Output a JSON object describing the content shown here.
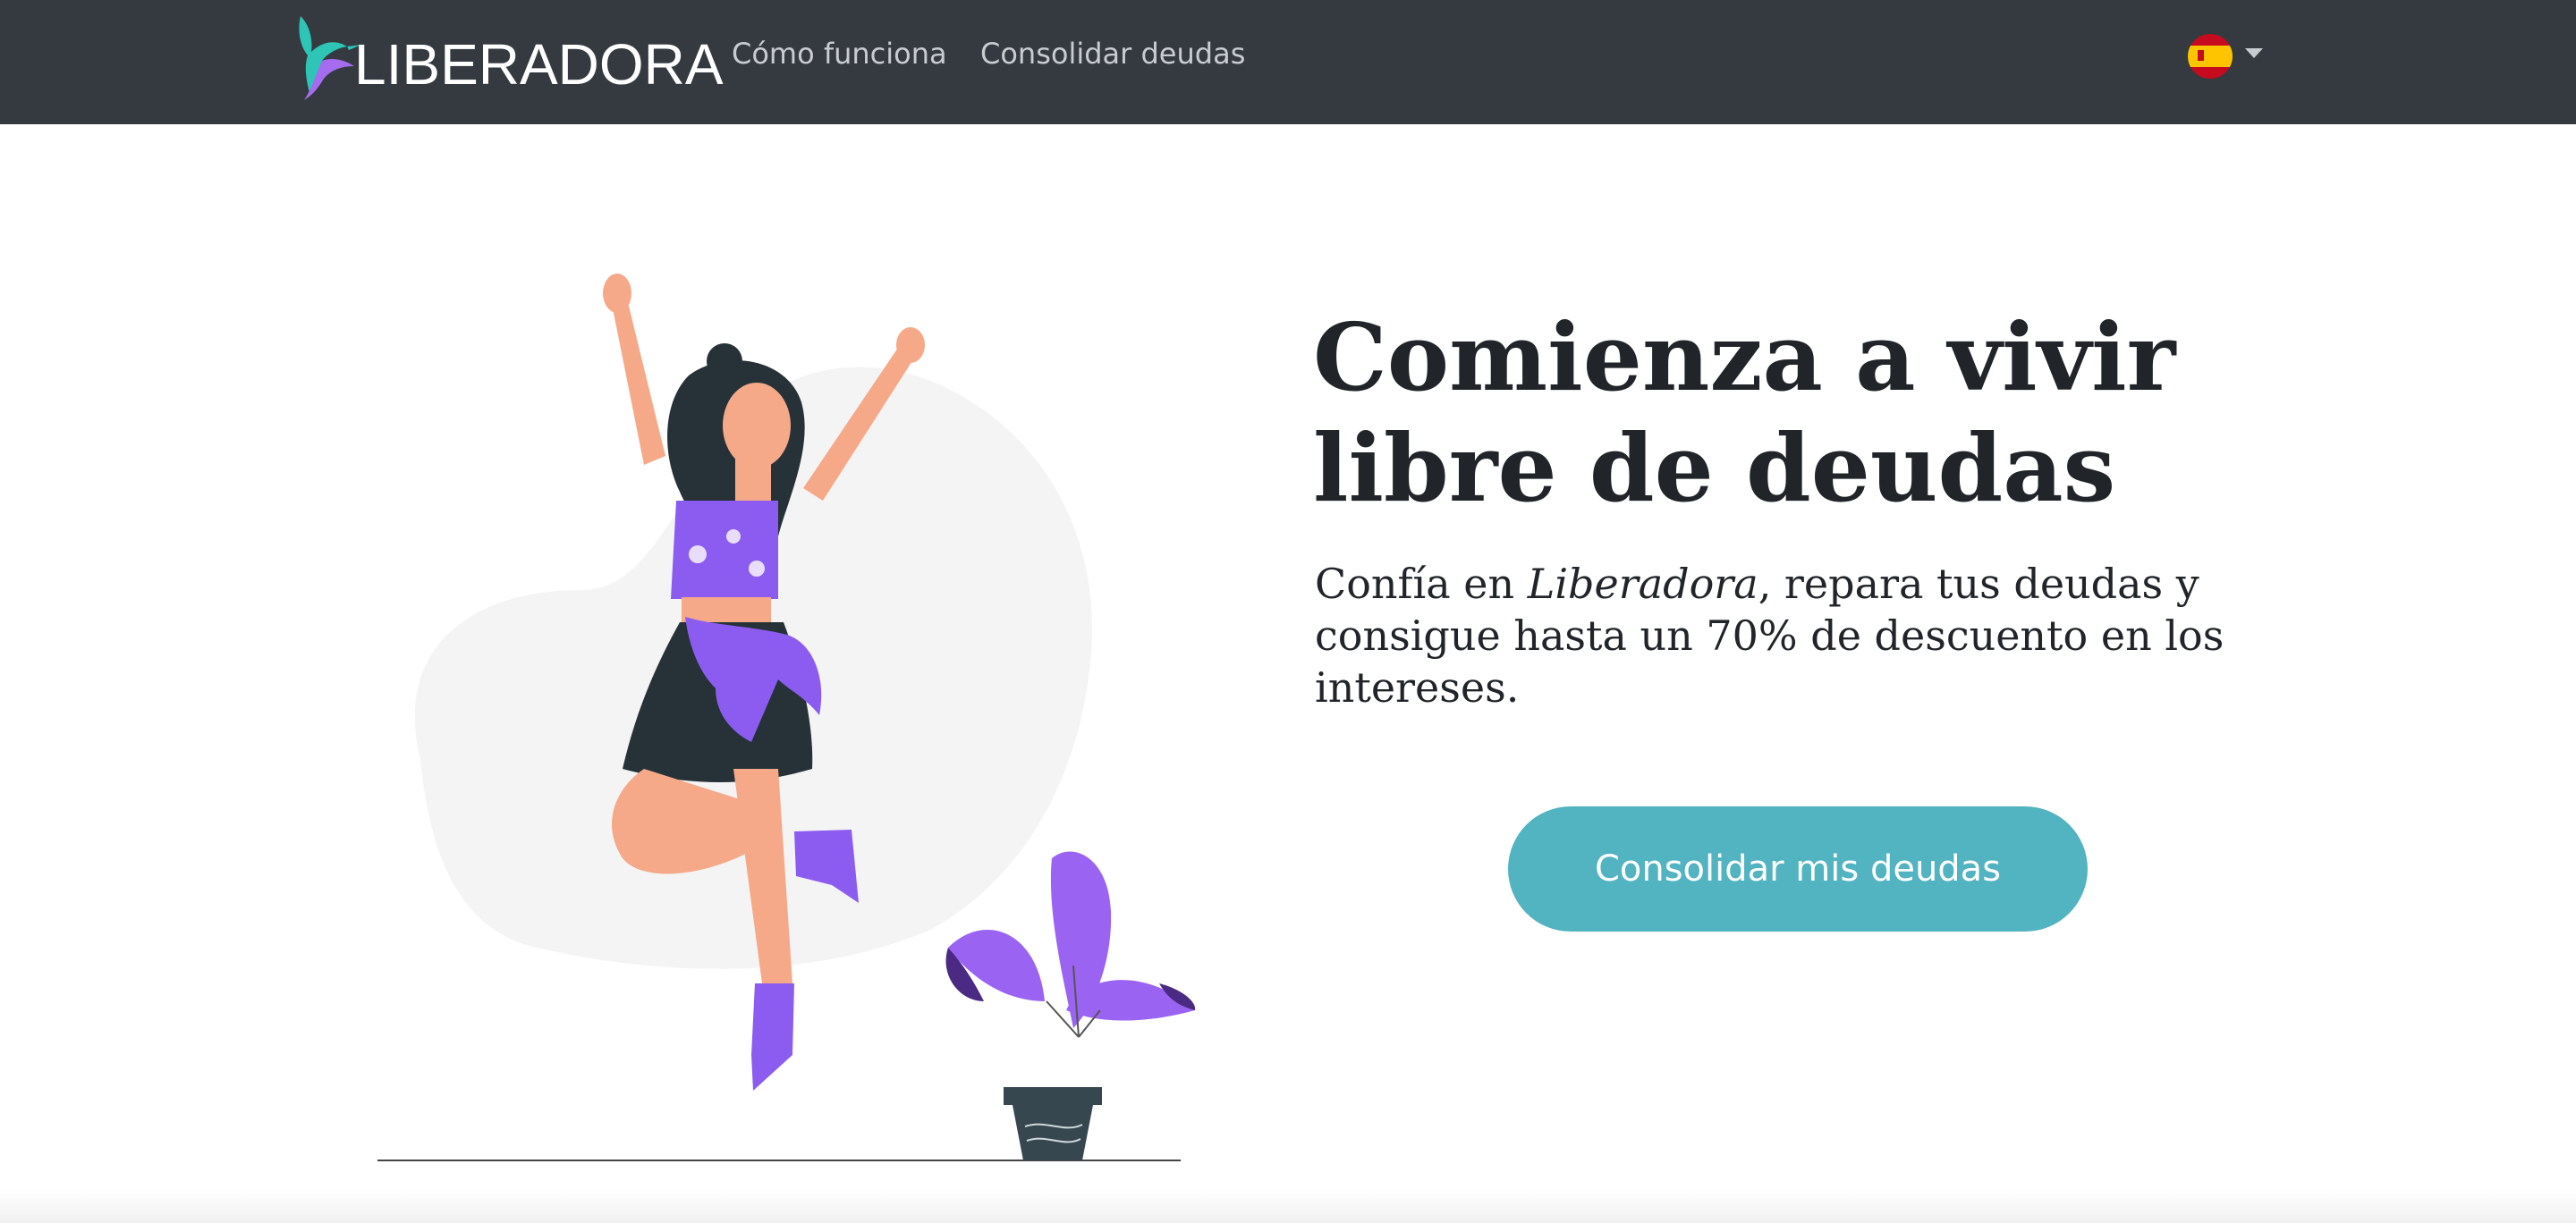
{
  "nav": {
    "brand": "LIBERADORA",
    "links": [
      "Cómo funciona",
      "Consolidar deudas"
    ],
    "language_icon": "spain-flag-icon"
  },
  "hero": {
    "title": "Comienza a vivir libre de deudas",
    "subtitle_pre": "Confía en ",
    "subtitle_em": "Liberadora",
    "subtitle_post": ", repara tus deudas y consigue hasta un 70% de descuento en los intereses.",
    "cta_label": "Consolidar mis deudas"
  },
  "colors": {
    "navbar": "#343a40",
    "cta": "#52b3c1",
    "accent_purple": "#8c5cf0"
  }
}
